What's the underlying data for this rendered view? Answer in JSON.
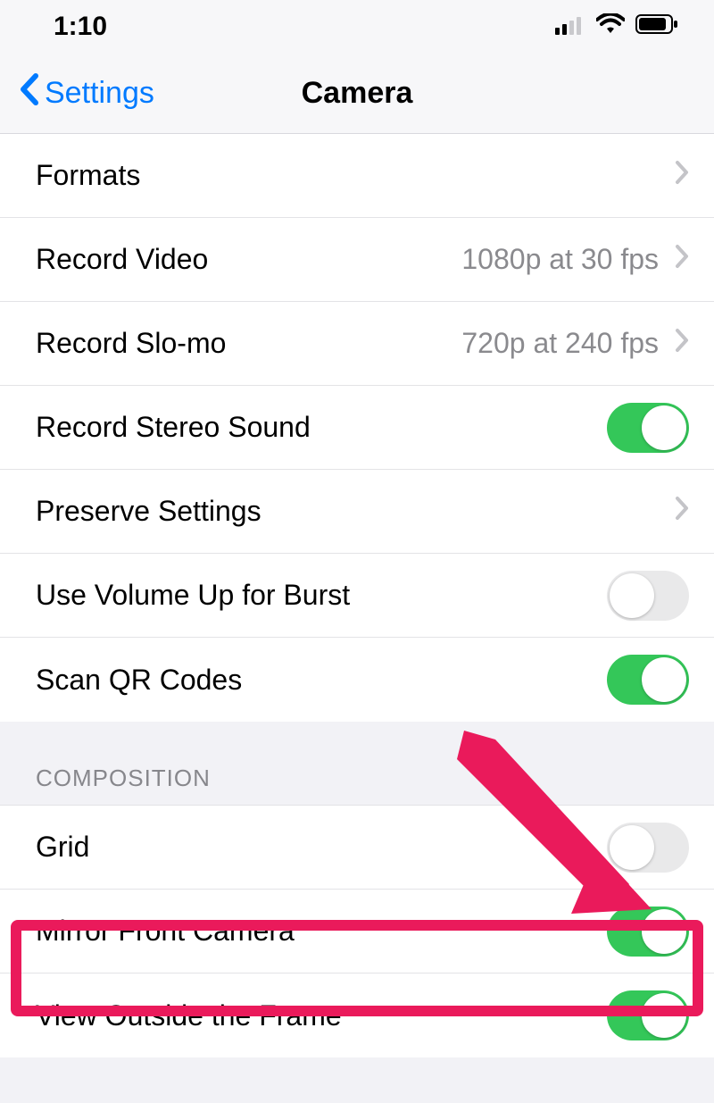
{
  "status_bar": {
    "time": "1:10"
  },
  "nav": {
    "back_label": "Settings",
    "title": "Camera"
  },
  "section1": {
    "formats": {
      "label": "Formats"
    },
    "record_video": {
      "label": "Record Video",
      "value": "1080p at 30 fps"
    },
    "record_slomo": {
      "label": "Record Slo-mo",
      "value": "720p at 240 fps"
    },
    "stereo": {
      "label": "Record Stereo Sound",
      "on": true
    },
    "preserve": {
      "label": "Preserve Settings"
    },
    "volume_burst": {
      "label": "Use Volume Up for Burst",
      "on": false
    },
    "scan_qr": {
      "label": "Scan QR Codes",
      "on": true
    }
  },
  "section2": {
    "header": "Composition",
    "grid": {
      "label": "Grid",
      "on": false
    },
    "mirror": {
      "label": "Mirror Front Camera",
      "on": true
    },
    "view_outside": {
      "label": "View Outside the Frame",
      "on": true
    }
  },
  "annotation": {
    "highlight_target": "mirror-front-camera-row",
    "arrow_color": "#ea1a5b"
  }
}
